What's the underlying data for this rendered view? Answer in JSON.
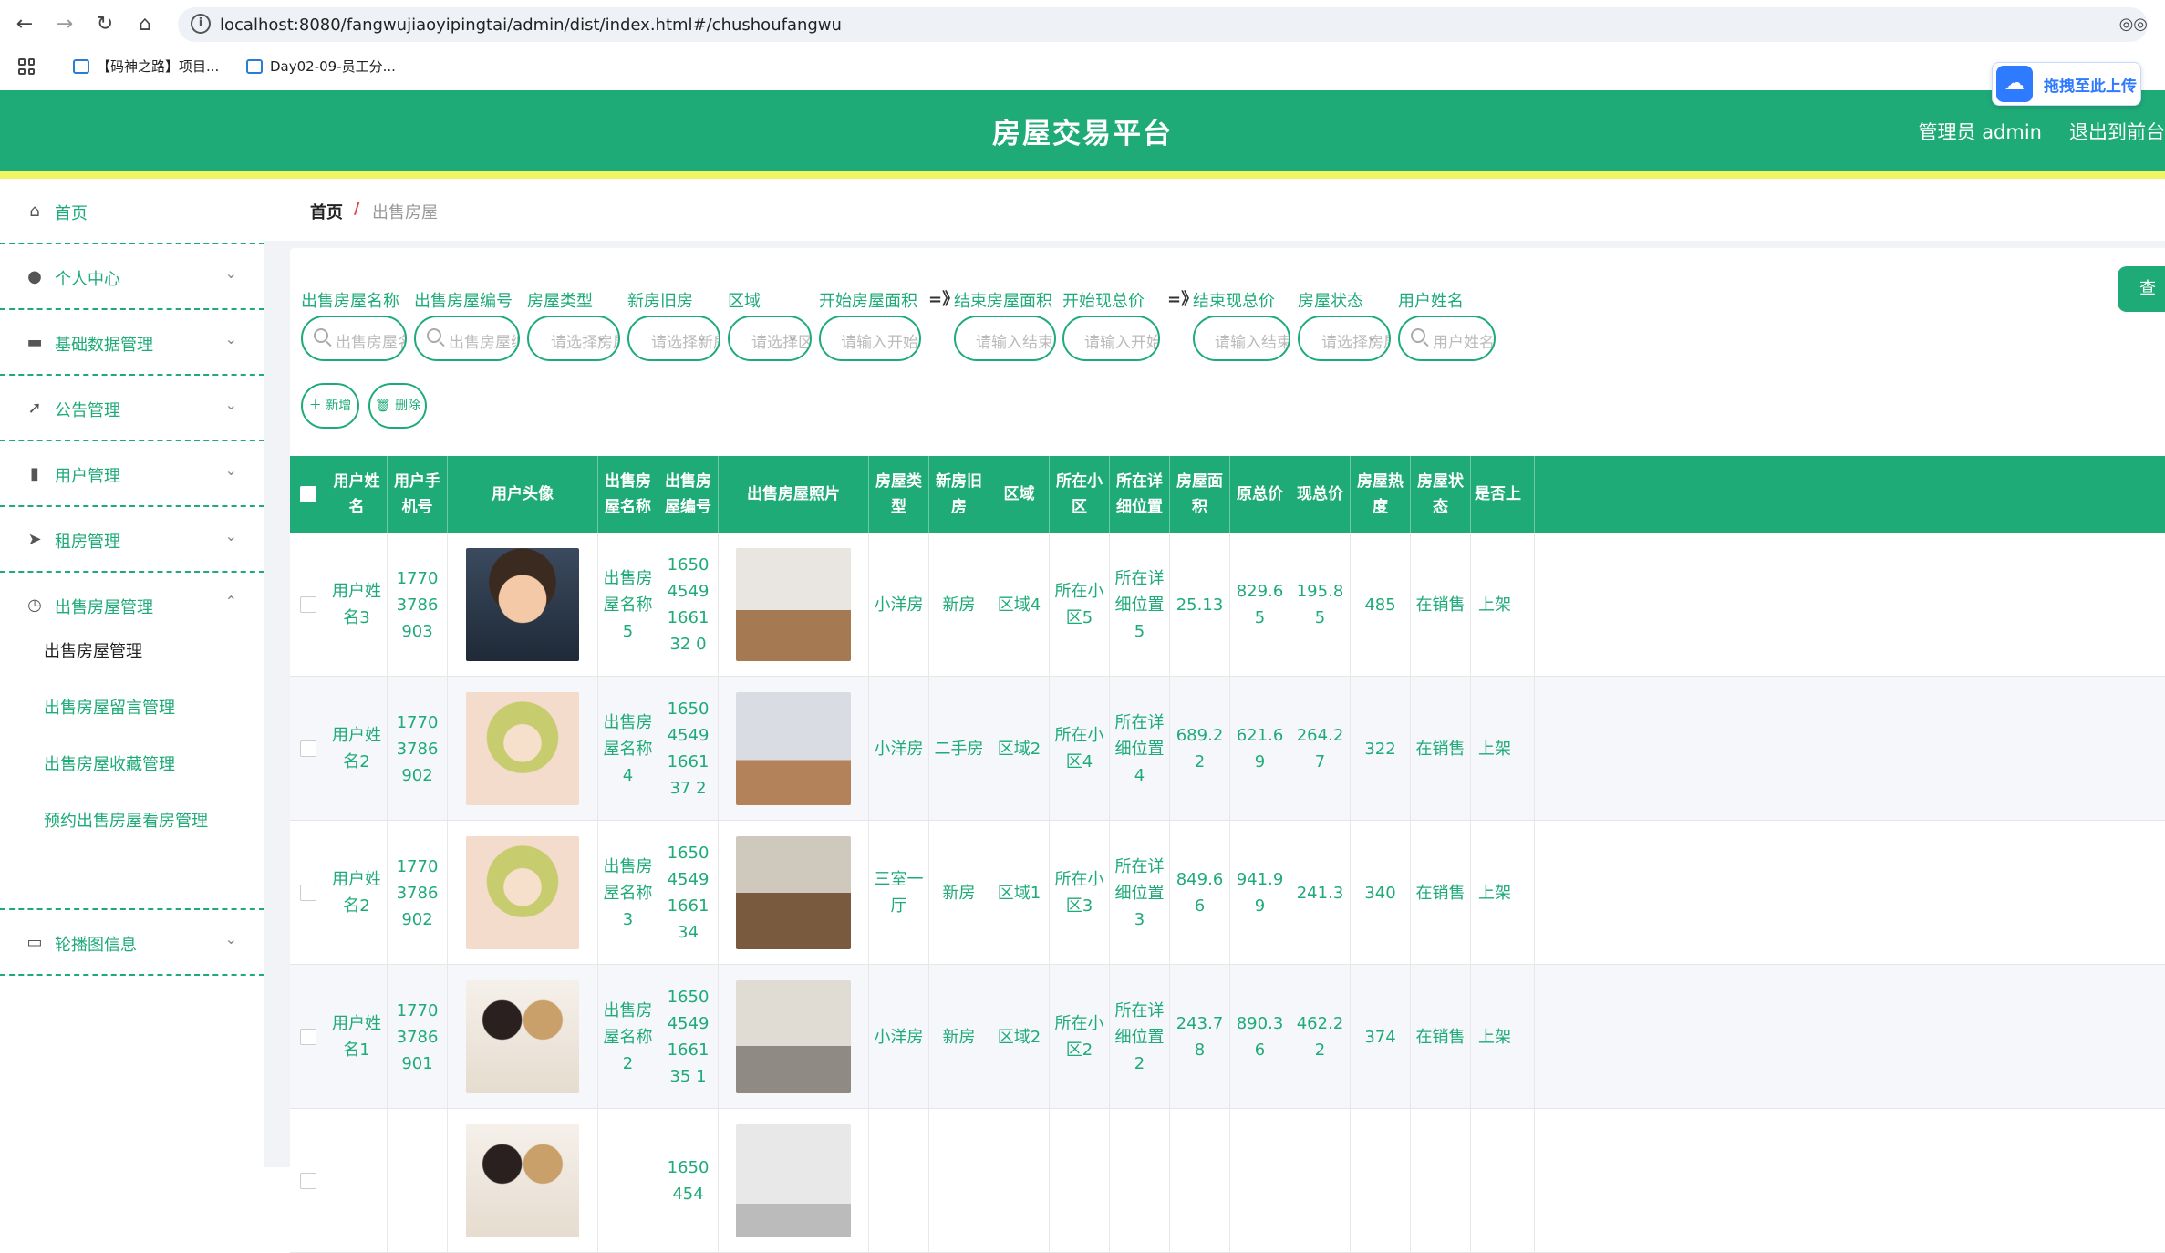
{
  "browser": {
    "url": "localhost:8080/fangwujiaoyipingtai/admin/dist/index.html#/chushoufangwu",
    "bookmarks": [
      "【码神之路】项目...",
      "Day02-09-员工分..."
    ],
    "upload_label": "拖拽至此上传"
  },
  "header": {
    "title": "房屋交易平台",
    "role": "管理员 admin",
    "logout": "退出到前台"
  },
  "sidebar": {
    "items": [
      {
        "label": "首页",
        "icon": "home-icon"
      },
      {
        "label": "个人中心",
        "icon": "user-icon"
      },
      {
        "label": "基础数据管理",
        "icon": "briefcase-icon"
      },
      {
        "label": "公告管理",
        "icon": "send-icon"
      },
      {
        "label": "用户管理",
        "icon": "bar-chart-icon"
      },
      {
        "label": "租房管理",
        "icon": "paper-plane-icon"
      },
      {
        "label": "出售房屋管理",
        "icon": "clock-icon"
      },
      {
        "label": "轮播图信息",
        "icon": "storage-icon"
      }
    ],
    "subitems": [
      "出售房屋管理",
      "出售房屋留言管理",
      "出售房屋收藏管理",
      "预约出售房屋看房管理"
    ]
  },
  "breadcrumb": {
    "home": "首页",
    "sep": "/",
    "current": "出售房屋"
  },
  "filters": {
    "labels": [
      "出售房屋名称",
      "出售房屋编号",
      "房屋类型",
      "新房旧房",
      "区域",
      "开始房屋面积",
      "结束房屋面积",
      "开始现总价",
      "结束现总价",
      "房屋状态",
      "用户姓名"
    ],
    "arrow": "=》",
    "placeholders": [
      "出售房屋名称",
      "出售房屋编号",
      "请选择房屋类型",
      "请选择新房旧房",
      "请选择区域",
      "请输入开始房屋面积",
      "请输入结束房屋面积",
      "请输入开始现",
      "请输入结束现",
      "请选择房屋状态",
      "用户姓名"
    ],
    "search_label": "查"
  },
  "actions": {
    "add": "＋ 新增",
    "delete": "🗑 删除"
  },
  "table": {
    "headers": [
      "用户姓名",
      "用户手机号",
      "用户头像",
      "出售房屋名称",
      "出售房屋编号",
      "出售房屋照片",
      "房屋类型",
      "新房旧房",
      "区域",
      "所在小区",
      "所在详细位置",
      "房屋面积",
      "原总价",
      "现总价",
      "房屋热度",
      "房屋状态",
      "是否上"
    ],
    "rows": [
      {
        "name": "用户姓名3",
        "phone": "17703786903",
        "title": "出售房屋名称5",
        "code": "16504549166132 0",
        "type": "小洋房",
        "newold": "新房",
        "area": "区域4",
        "community": "所在小区5",
        "location": "所在详细位置5",
        "size": "25.13",
        "orig": "829.65",
        "now": "195.85",
        "heat": "485",
        "status": "在销售",
        "shelf": "上架"
      },
      {
        "name": "用户姓名2",
        "phone": "17703786902",
        "title": "出售房屋名称4",
        "code": "16504549166137 2",
        "type": "小洋房",
        "newold": "二手房",
        "area": "区域2",
        "community": "所在小区4",
        "location": "所在详细位置4",
        "size": "689.22",
        "orig": "621.69",
        "now": "264.27",
        "heat": "322",
        "status": "在销售",
        "shelf": "上架"
      },
      {
        "name": "用户姓名2",
        "phone": "17703786902",
        "title": "出售房屋名称3",
        "code": "16504549166134",
        "type": "三室一厅",
        "newold": "新房",
        "area": "区域1",
        "community": "所在小区3",
        "location": "所在详细位置3",
        "size": "849.66",
        "orig": "941.99",
        "now": "241.3",
        "heat": "340",
        "status": "在销售",
        "shelf": "上架"
      },
      {
        "name": "用户姓名1",
        "phone": "17703786901",
        "title": "出售房屋名称2",
        "code": "16504549166135 1",
        "type": "小洋房",
        "newold": "新房",
        "area": "区域2",
        "community": "所在小区2",
        "location": "所在详细位置2",
        "size": "243.78",
        "orig": "890.36",
        "now": "462.22",
        "heat": "374",
        "status": "在销售",
        "shelf": "上架"
      },
      {
        "name": "",
        "phone": "",
        "title": "",
        "code": "1650454",
        "type": "",
        "newold": "",
        "area": "",
        "community": "",
        "location": "",
        "size": "",
        "orig": "",
        "now": "",
        "heat": "",
        "status": "",
        "shelf": ""
      }
    ]
  },
  "colors": {
    "primary": "#1fab78",
    "highlight": "#f0f564"
  }
}
